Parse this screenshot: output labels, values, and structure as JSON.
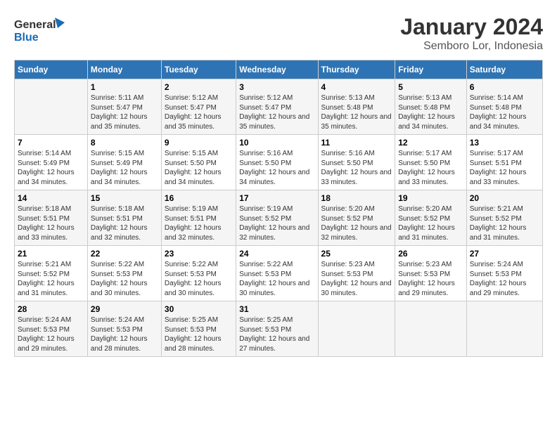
{
  "header": {
    "logo_general": "General",
    "logo_blue": "Blue",
    "month_title": "January 2024",
    "location": "Semboro Lor, Indonesia"
  },
  "columns": [
    "Sunday",
    "Monday",
    "Tuesday",
    "Wednesday",
    "Thursday",
    "Friday",
    "Saturday"
  ],
  "weeks": [
    [
      {
        "day": "",
        "sunrise": "",
        "sunset": "",
        "daylight": ""
      },
      {
        "day": "1",
        "sunrise": "Sunrise: 5:11 AM",
        "sunset": "Sunset: 5:47 PM",
        "daylight": "Daylight: 12 hours and 35 minutes."
      },
      {
        "day": "2",
        "sunrise": "Sunrise: 5:12 AM",
        "sunset": "Sunset: 5:47 PM",
        "daylight": "Daylight: 12 hours and 35 minutes."
      },
      {
        "day": "3",
        "sunrise": "Sunrise: 5:12 AM",
        "sunset": "Sunset: 5:47 PM",
        "daylight": "Daylight: 12 hours and 35 minutes."
      },
      {
        "day": "4",
        "sunrise": "Sunrise: 5:13 AM",
        "sunset": "Sunset: 5:48 PM",
        "daylight": "Daylight: 12 hours and 35 minutes."
      },
      {
        "day": "5",
        "sunrise": "Sunrise: 5:13 AM",
        "sunset": "Sunset: 5:48 PM",
        "daylight": "Daylight: 12 hours and 34 minutes."
      },
      {
        "day": "6",
        "sunrise": "Sunrise: 5:14 AM",
        "sunset": "Sunset: 5:48 PM",
        "daylight": "Daylight: 12 hours and 34 minutes."
      }
    ],
    [
      {
        "day": "7",
        "sunrise": "Sunrise: 5:14 AM",
        "sunset": "Sunset: 5:49 PM",
        "daylight": "Daylight: 12 hours and 34 minutes."
      },
      {
        "day": "8",
        "sunrise": "Sunrise: 5:15 AM",
        "sunset": "Sunset: 5:49 PM",
        "daylight": "Daylight: 12 hours and 34 minutes."
      },
      {
        "day": "9",
        "sunrise": "Sunrise: 5:15 AM",
        "sunset": "Sunset: 5:50 PM",
        "daylight": "Daylight: 12 hours and 34 minutes."
      },
      {
        "day": "10",
        "sunrise": "Sunrise: 5:16 AM",
        "sunset": "Sunset: 5:50 PM",
        "daylight": "Daylight: 12 hours and 34 minutes."
      },
      {
        "day": "11",
        "sunrise": "Sunrise: 5:16 AM",
        "sunset": "Sunset: 5:50 PM",
        "daylight": "Daylight: 12 hours and 33 minutes."
      },
      {
        "day": "12",
        "sunrise": "Sunrise: 5:17 AM",
        "sunset": "Sunset: 5:50 PM",
        "daylight": "Daylight: 12 hours and 33 minutes."
      },
      {
        "day": "13",
        "sunrise": "Sunrise: 5:17 AM",
        "sunset": "Sunset: 5:51 PM",
        "daylight": "Daylight: 12 hours and 33 minutes."
      }
    ],
    [
      {
        "day": "14",
        "sunrise": "Sunrise: 5:18 AM",
        "sunset": "Sunset: 5:51 PM",
        "daylight": "Daylight: 12 hours and 33 minutes."
      },
      {
        "day": "15",
        "sunrise": "Sunrise: 5:18 AM",
        "sunset": "Sunset: 5:51 PM",
        "daylight": "Daylight: 12 hours and 32 minutes."
      },
      {
        "day": "16",
        "sunrise": "Sunrise: 5:19 AM",
        "sunset": "Sunset: 5:51 PM",
        "daylight": "Daylight: 12 hours and 32 minutes."
      },
      {
        "day": "17",
        "sunrise": "Sunrise: 5:19 AM",
        "sunset": "Sunset: 5:52 PM",
        "daylight": "Daylight: 12 hours and 32 minutes."
      },
      {
        "day": "18",
        "sunrise": "Sunrise: 5:20 AM",
        "sunset": "Sunset: 5:52 PM",
        "daylight": "Daylight: 12 hours and 32 minutes."
      },
      {
        "day": "19",
        "sunrise": "Sunrise: 5:20 AM",
        "sunset": "Sunset: 5:52 PM",
        "daylight": "Daylight: 12 hours and 31 minutes."
      },
      {
        "day": "20",
        "sunrise": "Sunrise: 5:21 AM",
        "sunset": "Sunset: 5:52 PM",
        "daylight": "Daylight: 12 hours and 31 minutes."
      }
    ],
    [
      {
        "day": "21",
        "sunrise": "Sunrise: 5:21 AM",
        "sunset": "Sunset: 5:52 PM",
        "daylight": "Daylight: 12 hours and 31 minutes."
      },
      {
        "day": "22",
        "sunrise": "Sunrise: 5:22 AM",
        "sunset": "Sunset: 5:53 PM",
        "daylight": "Daylight: 12 hours and 30 minutes."
      },
      {
        "day": "23",
        "sunrise": "Sunrise: 5:22 AM",
        "sunset": "Sunset: 5:53 PM",
        "daylight": "Daylight: 12 hours and 30 minutes."
      },
      {
        "day": "24",
        "sunrise": "Sunrise: 5:22 AM",
        "sunset": "Sunset: 5:53 PM",
        "daylight": "Daylight: 12 hours and 30 minutes."
      },
      {
        "day": "25",
        "sunrise": "Sunrise: 5:23 AM",
        "sunset": "Sunset: 5:53 PM",
        "daylight": "Daylight: 12 hours and 30 minutes."
      },
      {
        "day": "26",
        "sunrise": "Sunrise: 5:23 AM",
        "sunset": "Sunset: 5:53 PM",
        "daylight": "Daylight: 12 hours and 29 minutes."
      },
      {
        "day": "27",
        "sunrise": "Sunrise: 5:24 AM",
        "sunset": "Sunset: 5:53 PM",
        "daylight": "Daylight: 12 hours and 29 minutes."
      }
    ],
    [
      {
        "day": "28",
        "sunrise": "Sunrise: 5:24 AM",
        "sunset": "Sunset: 5:53 PM",
        "daylight": "Daylight: 12 hours and 29 minutes."
      },
      {
        "day": "29",
        "sunrise": "Sunrise: 5:24 AM",
        "sunset": "Sunset: 5:53 PM",
        "daylight": "Daylight: 12 hours and 28 minutes."
      },
      {
        "day": "30",
        "sunrise": "Sunrise: 5:25 AM",
        "sunset": "Sunset: 5:53 PM",
        "daylight": "Daylight: 12 hours and 28 minutes."
      },
      {
        "day": "31",
        "sunrise": "Sunrise: 5:25 AM",
        "sunset": "Sunset: 5:53 PM",
        "daylight": "Daylight: 12 hours and 27 minutes."
      },
      {
        "day": "",
        "sunrise": "",
        "sunset": "",
        "daylight": ""
      },
      {
        "day": "",
        "sunrise": "",
        "sunset": "",
        "daylight": ""
      },
      {
        "day": "",
        "sunrise": "",
        "sunset": "",
        "daylight": ""
      }
    ]
  ]
}
